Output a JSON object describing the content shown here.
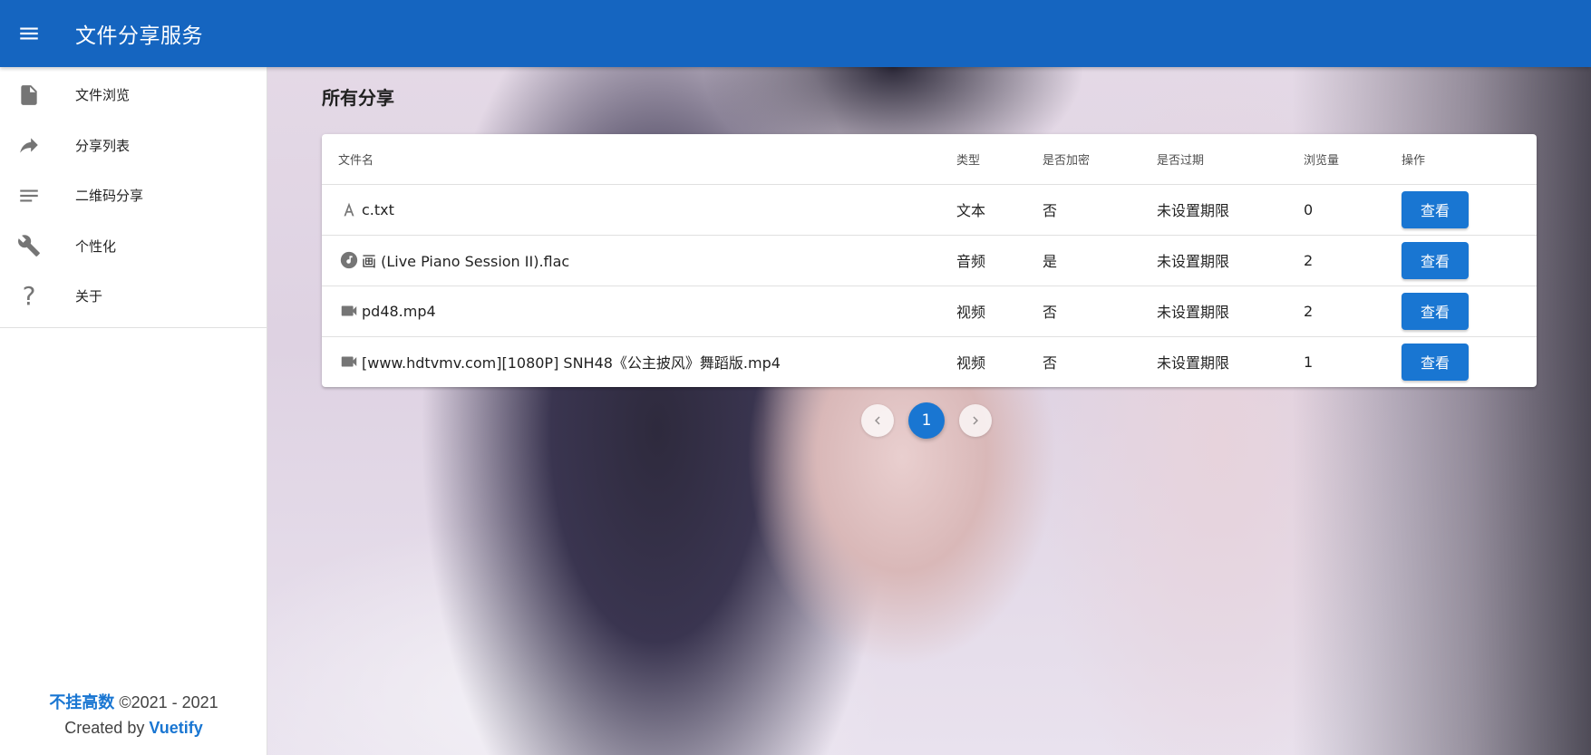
{
  "app": {
    "title": "文件分享服务"
  },
  "sidebar": {
    "items": [
      {
        "label": "文件浏览",
        "icon": "file-icon"
      },
      {
        "label": "分享列表",
        "icon": "share-icon"
      },
      {
        "label": "二维码分享",
        "icon": "lines-icon"
      },
      {
        "label": "个性化",
        "icon": "wrench-icon"
      },
      {
        "label": "关于",
        "icon": "question-icon"
      }
    ],
    "footer": {
      "author": "不挂高数",
      "copyright": "©2021 - 2021",
      "created_by": "Created by",
      "framework": "Vuetify"
    }
  },
  "main": {
    "heading": "所有分享",
    "table": {
      "headers": [
        "文件名",
        "类型",
        "是否加密",
        "是否过期",
        "浏览量",
        "操作"
      ],
      "rows": [
        {
          "icon": "text-icon",
          "name": "c.txt",
          "type": "文本",
          "encrypted": "否",
          "expiry": "未设置期限",
          "views": "0",
          "action": "查看"
        },
        {
          "icon": "music-icon",
          "name": "画 (Live Piano Session II).flac",
          "type": "音频",
          "encrypted": "是",
          "expiry": "未设置期限",
          "views": "2",
          "action": "查看"
        },
        {
          "icon": "video-icon",
          "name": "pd48.mp4",
          "type": "视频",
          "encrypted": "否",
          "expiry": "未设置期限",
          "views": "2",
          "action": "查看"
        },
        {
          "icon": "video-icon",
          "name": "[www.hdtvmv.com][1080P] SNH48《公主披风》舞蹈版.mp4",
          "type": "视频",
          "encrypted": "否",
          "expiry": "未设置期限",
          "views": "1",
          "action": "查看"
        }
      ]
    },
    "pagination": {
      "current_page": "1"
    }
  },
  "colors": {
    "primary": "#1565C0",
    "button": "#1976D2"
  }
}
